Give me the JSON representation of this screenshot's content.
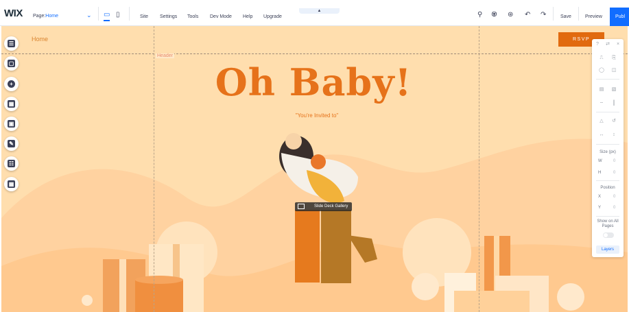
{
  "topbar": {
    "logo": "WIX",
    "page_label": "Page:",
    "page_value": "Home",
    "menu": [
      "Site",
      "Settings",
      "Tools",
      "Dev Mode",
      "Help",
      "Upgrade"
    ],
    "save": "Save",
    "preview": "Preview",
    "publish": "Publ"
  },
  "canvas": {
    "home_link": "Home",
    "header_tag": "Header",
    "rsvp": "RSVP",
    "title": "Oh Baby!",
    "subtitle": "\"You're Invited to\"",
    "gallery_label": "Slide Deck Gallery"
  },
  "inspector": {
    "size_label": "Size (px)",
    "w_label": "W",
    "h_label": "H",
    "w_value": "0",
    "h_value": "0",
    "position_label": "Position",
    "x_label": "X",
    "y_label": "Y",
    "x_value": "0",
    "y_value": "0",
    "show_all_pages": "Show on All Pages",
    "layers": "Layers"
  },
  "colors": {
    "accent": "#116dff",
    "canvas_bg": "#ffdeae",
    "brand_orange": "#e6721a",
    "rsvp_bg": "#e16a0f"
  },
  "icons": {
    "left_tools": [
      "pages-icon",
      "add-elements-icon",
      "add-apps-icon",
      "app-market-icon",
      "media-icon",
      "blog-icon",
      "events-icon",
      "business-icon"
    ]
  }
}
